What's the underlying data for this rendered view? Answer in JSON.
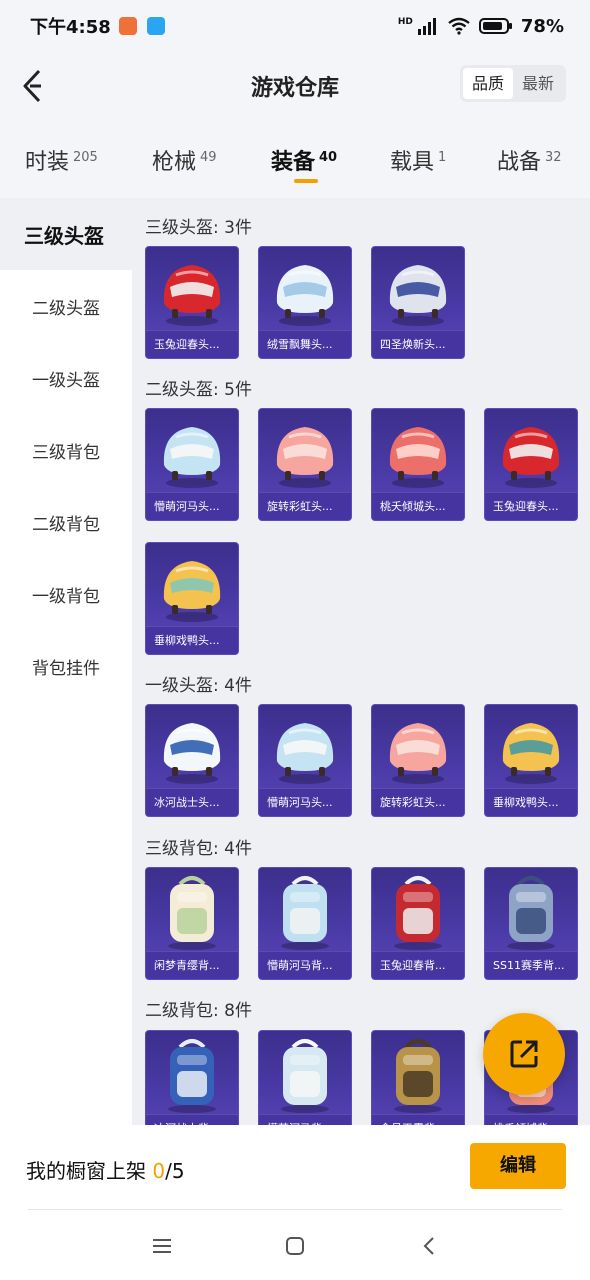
{
  "status_bar": {
    "time": "下午4:58",
    "battery": "78%",
    "network": "HD"
  },
  "header": {
    "title": "游戏仓库",
    "sort_options": [
      "品质",
      "最新"
    ],
    "sort_active": "品质"
  },
  "tabs": [
    {
      "label": "时装",
      "count": "205"
    },
    {
      "label": "枪械",
      "count": "49"
    },
    {
      "label": "装备",
      "count": "40",
      "active": true
    },
    {
      "label": "载具",
      "count": "1"
    },
    {
      "label": "战备",
      "count": "32"
    }
  ],
  "sidebar": {
    "items": [
      {
        "label": "三级头盔",
        "active": true
      },
      {
        "label": "二级头盔"
      },
      {
        "label": "一级头盔"
      },
      {
        "label": "三级背包"
      },
      {
        "label": "二级背包"
      },
      {
        "label": "一级背包"
      },
      {
        "label": "背包挂件"
      }
    ]
  },
  "sections": [
    {
      "title": "三级头盔: 3件",
      "items": [
        {
          "name": "玉兔迎春头...",
          "icon": "helmet-icon",
          "colors": [
            "#d8282e",
            "#f2f2f2"
          ]
        },
        {
          "name": "绒雪飘舞头...",
          "icon": "helmet-icon",
          "colors": [
            "#e9f2fa",
            "#9bc6e6"
          ]
        },
        {
          "name": "四圣焕新头...",
          "icon": "helmet-icon",
          "colors": [
            "#dfe3ee",
            "#384a9c"
          ]
        }
      ]
    },
    {
      "title": "二级头盔: 5件",
      "items": [
        {
          "name": "懵萌河马头...",
          "icon": "helmet-icon",
          "colors": [
            "#c4e3f3",
            "#f7f7f7"
          ]
        },
        {
          "name": "旋转彩虹头...",
          "icon": "helmet-icon",
          "colors": [
            "#f6a69e",
            "#fbe2dc"
          ]
        },
        {
          "name": "桃夭倾城头...",
          "icon": "helmet-icon",
          "colors": [
            "#ec6f6a",
            "#ffd9d2"
          ]
        },
        {
          "name": "玉兔迎春头...",
          "icon": "helmet-icon",
          "colors": [
            "#d8282e",
            "#f2f2f2"
          ]
        },
        {
          "name": "垂柳戏鸭头...",
          "icon": "helmet-icon",
          "colors": [
            "#f4c24f",
            "#86c7b8"
          ]
        }
      ]
    },
    {
      "title": "一级头盔: 4件",
      "items": [
        {
          "name": "冰河战士头...",
          "icon": "helmet-icon",
          "colors": [
            "#f3f6fa",
            "#2f5fb0"
          ]
        },
        {
          "name": "懵萌河马头...",
          "icon": "helmet-icon",
          "colors": [
            "#c4e3f3",
            "#f7f7f7"
          ]
        },
        {
          "name": "旋转彩虹头...",
          "icon": "helmet-icon",
          "colors": [
            "#f6a69e",
            "#fbe2dc"
          ]
        },
        {
          "name": "垂柳戏鸭头...",
          "icon": "helmet-icon",
          "colors": [
            "#f4c24f",
            "#4a9aa0"
          ]
        }
      ]
    },
    {
      "title": "三级背包: 4件",
      "items": [
        {
          "name": "闲梦青缨背...",
          "icon": "backpack-icon",
          "colors": [
            "#f3ecd6",
            "#b6d39a"
          ]
        },
        {
          "name": "懵萌河马背...",
          "icon": "backpack-icon",
          "colors": [
            "#bfe0f0",
            "#f2f2f2"
          ]
        },
        {
          "name": "玉兔迎春背...",
          "icon": "backpack-icon",
          "colors": [
            "#c42a30",
            "#f0f0f0"
          ]
        },
        {
          "name": "SS11赛季背...",
          "icon": "backpack-icon",
          "colors": [
            "#8fa3c6",
            "#3b4f7e"
          ]
        }
      ]
    },
    {
      "title": "二级背包: 8件",
      "items": [
        {
          "name": "冰河战士背...",
          "icon": "backpack-icon",
          "colors": [
            "#3561b8",
            "#e9eef6"
          ]
        },
        {
          "name": "懵萌河马背...",
          "icon": "backpack-icon",
          "colors": [
            "#d6e8f2",
            "#f7f7f7"
          ]
        },
        {
          "name": "金月天霞背...",
          "icon": "backpack-icon",
          "colors": [
            "#b8934a",
            "#4a3a24"
          ]
        },
        {
          "name": "桃夭倾城背...",
          "icon": "backpack-icon",
          "colors": [
            "#f08c78",
            "#fbd6c8"
          ]
        }
      ]
    }
  ],
  "bottom": {
    "shelf_label": "我的橱窗上架",
    "shelf_current": "0",
    "shelf_total": "/5",
    "edit_label": "编辑"
  },
  "colors": {
    "accent": "#f6a800",
    "card_bg": "#4a3aa6"
  }
}
